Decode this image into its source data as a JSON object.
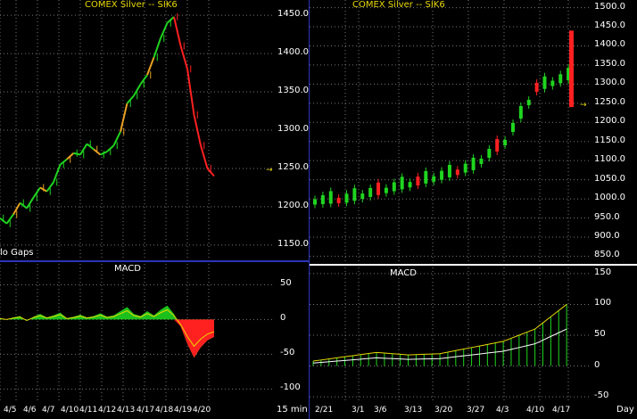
{
  "colors": {
    "up": "#1fd51f",
    "down": "#ff2020",
    "neutral": "#e8a020",
    "grid": "#777",
    "macd_fill": "#1fd51f",
    "signal": "#e8d800",
    "price_marker": "#e8d800"
  },
  "left_chart": {
    "title": "COMEX Silver -- SIK6",
    "note": "lo Gaps",
    "y_ticks": [
      "1450.0",
      "1400.0",
      "1350.0",
      "1300.0",
      "1250.0",
      "1200.0",
      "1150.0"
    ],
    "x_ticks": [
      "4/5",
      "4/6",
      "4/7",
      "4/10",
      "4/11",
      "4/12",
      "4/13",
      "4/17",
      "4/18",
      "4/19",
      "4/20"
    ],
    "units": "15 min",
    "macd_title": "MACD",
    "macd_y_ticks": [
      "50",
      "0",
      "-50",
      "-100"
    ]
  },
  "right_chart": {
    "title": "COMEX Silver -- SIK6",
    "y_ticks": [
      "1500.0",
      "1450.0",
      "1400.0",
      "1350.0",
      "1300.0",
      "1250.0",
      "1200.0",
      "1150.0",
      "1100.0",
      "1050.0",
      "1000.0",
      "950.0",
      "900.0",
      "850.0"
    ],
    "x_ticks": [
      "2/21",
      "3/1",
      "3/6",
      "3/13",
      "3/20",
      "3/27",
      "4/3",
      "4/10",
      "4/17"
    ],
    "units": "Day",
    "macd_title": "MACD",
    "macd_y_ticks": [
      "150",
      "100",
      "50",
      "0",
      "-50"
    ]
  },
  "chart_data": [
    {
      "type": "line",
      "title": "COMEX Silver -- SIK6",
      "series": [
        {
          "name": "",
          "values": [
            1185,
            1178,
            1190,
            1205,
            1198,
            1212,
            1225,
            1220,
            1232,
            1255,
            1262,
            1270,
            1268,
            1282,
            1275,
            1268,
            1272,
            1280,
            1298,
            1335,
            1345,
            1360,
            1372,
            1395,
            1420,
            1440,
            1448,
            1410,
            1380,
            1320,
            1280,
            1250,
            1240
          ]
        }
      ],
      "ylim": [
        1130,
        1470
      ]
    },
    {
      "type": "line",
      "title": "MACD",
      "series": [
        {
          "name": "",
          "values": [
            2,
            0,
            3,
            5,
            -2,
            4,
            8,
            3,
            6,
            10,
            2,
            4,
            7,
            3,
            5,
            9,
            4,
            6,
            12,
            18,
            8,
            5,
            12,
            6,
            14,
            20,
            8,
            -10,
            -35,
            -55,
            -40,
            -30,
            -25
          ]
        }
      ],
      "ylim": [
        -120,
        80
      ]
    },
    {
      "type": "bar",
      "title": "COMEX Silver -- SIK6",
      "categories": [
        "2/21",
        "3/1",
        "3/6",
        "3/13",
        "3/20",
        "3/27",
        "4/3",
        "4/10",
        "4/17"
      ],
      "values": [
        985,
        990,
        1010,
        1030,
        1050,
        1075,
        1140,
        1280,
        1310
      ],
      "ylim": [
        830,
        1520
      ]
    },
    {
      "type": "bar",
      "title": "MACD",
      "categories": [
        "2/21",
        "3/1",
        "3/6",
        "3/13",
        "3/20",
        "3/27",
        "4/3",
        "4/10",
        "4/17"
      ],
      "values": [
        8,
        15,
        22,
        18,
        20,
        30,
        40,
        60,
        100
      ],
      "ylim": [
        -60,
        160
      ]
    }
  ]
}
